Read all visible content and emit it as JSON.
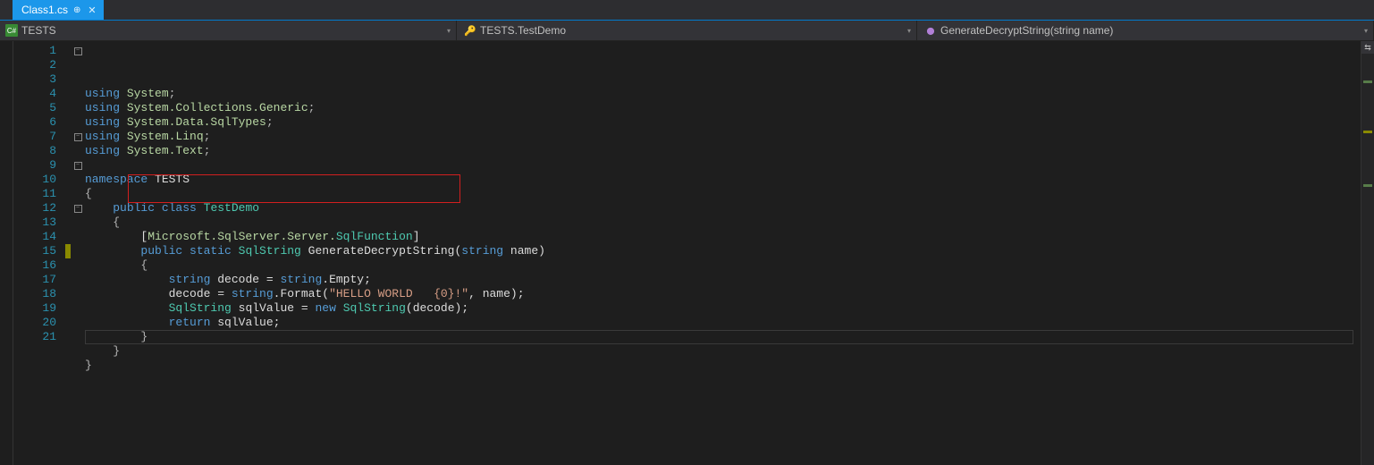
{
  "tab": {
    "title": "Class1.cs",
    "pin_glyph": "⊕",
    "close_glyph": "✕"
  },
  "nav": {
    "scope_icon": "C#",
    "scope_label": "TESTS",
    "class_icon": "🔑",
    "class_label": "TESTS.TestDemo",
    "member_icon": "⬤",
    "member_label": "GenerateDecryptString(string name)",
    "chev": "▾"
  },
  "code": {
    "lines": [
      {
        "n": "1",
        "outline": "box",
        "o": "|",
        "tokens": [
          [
            "key",
            "using "
          ],
          [
            "ns",
            "System"
          ],
          [
            "punc",
            ";"
          ]
        ]
      },
      {
        "n": "2",
        "outline": "",
        "o": "|",
        "tokens": [
          [
            "key",
            "using "
          ],
          [
            "ns",
            "System.Collections.Generic"
          ],
          [
            "punc",
            ";"
          ]
        ]
      },
      {
        "n": "3",
        "outline": "",
        "o": "|",
        "tokens": [
          [
            "key",
            "using "
          ],
          [
            "ns",
            "System.Data.SqlTypes"
          ],
          [
            "punc",
            ";"
          ]
        ]
      },
      {
        "n": "4",
        "outline": "",
        "o": "|",
        "tokens": [
          [
            "key",
            "using "
          ],
          [
            "ns",
            "System.Linq"
          ],
          [
            "punc",
            ";"
          ]
        ]
      },
      {
        "n": "5",
        "outline": "",
        "o": "|",
        "tokens": [
          [
            "key",
            "using "
          ],
          [
            "ns",
            "System.Text"
          ],
          [
            "punc",
            ";"
          ]
        ]
      },
      {
        "n": "6",
        "outline": "",
        "o": "",
        "tokens": []
      },
      {
        "n": "7",
        "outline": "box",
        "o": "",
        "tokens": [
          [
            "key",
            "namespace "
          ],
          [
            "id",
            "TESTS"
          ]
        ]
      },
      {
        "n": "8",
        "outline": "",
        "o": "|",
        "tokens": [
          [
            "punc",
            "{"
          ]
        ]
      },
      {
        "n": "9",
        "outline": "box",
        "o": "|",
        "tokens": [
          [
            "id",
            "    "
          ],
          [
            "key",
            "public "
          ],
          [
            "key",
            "class "
          ],
          [
            "type",
            "TestDemo"
          ]
        ]
      },
      {
        "n": "10",
        "outline": "",
        "o": "||",
        "tokens": [
          [
            "id",
            "    "
          ],
          [
            "punc",
            "{"
          ]
        ]
      },
      {
        "n": "11",
        "outline": "",
        "o": "||",
        "tokens": [
          [
            "id",
            "        ["
          ],
          [
            "ns",
            "Microsoft.SqlServer.Server."
          ],
          [
            "attr",
            "SqlFunction"
          ],
          [
            "id",
            "]"
          ]
        ]
      },
      {
        "n": "12",
        "outline": "box",
        "o": "||",
        "tokens": [
          [
            "id",
            "        "
          ],
          [
            "key",
            "public "
          ],
          [
            "key",
            "static "
          ],
          [
            "type",
            "SqlString"
          ],
          [
            "id",
            " GenerateDecryptString("
          ],
          [
            "key",
            "string"
          ],
          [
            "id",
            " name)"
          ]
        ]
      },
      {
        "n": "13",
        "outline": "",
        "o": "|||",
        "tokens": [
          [
            "id",
            "        "
          ],
          [
            "punc",
            "{"
          ]
        ]
      },
      {
        "n": "14",
        "outline": "",
        "o": "|||",
        "tokens": [
          [
            "id",
            "            "
          ],
          [
            "key",
            "string"
          ],
          [
            "id",
            " decode = "
          ],
          [
            "key",
            "string"
          ],
          [
            "id",
            ".Empty;"
          ]
        ]
      },
      {
        "n": "15",
        "outline": "",
        "o": "|||",
        "mark": "changed",
        "tokens": [
          [
            "id",
            "            decode = "
          ],
          [
            "key",
            "string"
          ],
          [
            "id",
            ".Format("
          ],
          [
            "str",
            "\"HELLO WORLD   {0}!\""
          ],
          [
            "id",
            ", name);"
          ]
        ]
      },
      {
        "n": "16",
        "outline": "",
        "o": "|||",
        "tokens": [
          [
            "id",
            "            "
          ],
          [
            "type",
            "SqlString"
          ],
          [
            "id",
            " sqlValue = "
          ],
          [
            "key",
            "new "
          ],
          [
            "type",
            "SqlString"
          ],
          [
            "id",
            "(decode);"
          ]
        ]
      },
      {
        "n": "17",
        "outline": "",
        "o": "|||",
        "tokens": [
          [
            "id",
            "            "
          ],
          [
            "key",
            "return"
          ],
          [
            "id",
            " sqlValue;"
          ]
        ]
      },
      {
        "n": "18",
        "outline": "",
        "o": "|||",
        "tokens": [
          [
            "id",
            "        "
          ],
          [
            "punc",
            "}"
          ]
        ]
      },
      {
        "n": "19",
        "outline": "",
        "o": "||",
        "tokens": [
          [
            "id",
            "    "
          ],
          [
            "punc",
            "}"
          ]
        ]
      },
      {
        "n": "20",
        "outline": "",
        "o": "|",
        "tokens": [
          [
            "punc",
            "}"
          ]
        ]
      },
      {
        "n": "21",
        "outline": "",
        "o": "",
        "caret": true,
        "tokens": []
      }
    ],
    "highlight": {
      "line_index": 10,
      "left_ch": 8,
      "width_ch": 62
    }
  },
  "right_rail": {
    "swap_glyph": "⇆"
  }
}
